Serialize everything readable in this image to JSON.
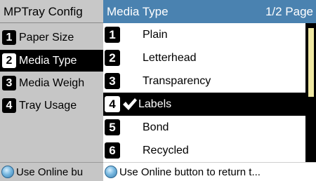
{
  "left_panel": {
    "title": "MPTray Config",
    "items": [
      {
        "num": "1",
        "label": "Paper Size"
      },
      {
        "num": "2",
        "label": "Media Type"
      },
      {
        "num": "3",
        "label": "Media Weigh"
      },
      {
        "num": "4",
        "label": "Tray Usage"
      }
    ],
    "selected_index": 1,
    "footer": "Use Online bu"
  },
  "right_panel": {
    "title": "Media Type",
    "page": "1/2 Page",
    "items": [
      {
        "num": "1",
        "label": "Plain"
      },
      {
        "num": "2",
        "label": "Letterhead"
      },
      {
        "num": "3",
        "label": "Transparency"
      },
      {
        "num": "4",
        "label": "Labels"
      },
      {
        "num": "5",
        "label": "Bond"
      },
      {
        "num": "6",
        "label": "Recycled"
      }
    ],
    "selected_index": 3,
    "checked_label": "Labels",
    "footer": "Use Online button to return t..."
  },
  "colors": {
    "header_blue": "#4a82b0",
    "left_bg": "#c6c6c6",
    "scroll_thumb": "#efe8a2",
    "selection": "#000000"
  },
  "icons": {
    "online": "online-button-icon",
    "check": "checkmark-icon"
  }
}
